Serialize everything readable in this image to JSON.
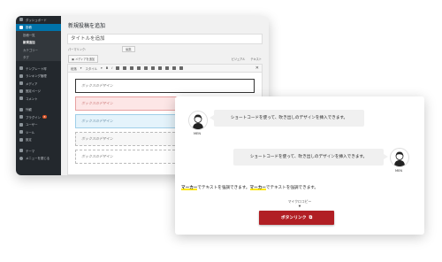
{
  "sidebar": {
    "items": [
      {
        "label": "ダッシュボード",
        "active": false
      },
      {
        "label": "投稿",
        "active": true
      },
      {
        "label": "投稿一覧",
        "sub": true
      },
      {
        "label": "新規追加",
        "sub": true,
        "current": true
      },
      {
        "label": "カテゴリー",
        "sub": true
      },
      {
        "label": "タグ",
        "sub": true
      },
      {
        "label": "テンプレート呼",
        "active": false
      },
      {
        "label": "ランキング管理",
        "active": false
      },
      {
        "label": "メディア",
        "active": false
      },
      {
        "label": "固定ページ",
        "active": false
      },
      {
        "label": "コメント",
        "active": false
      },
      {
        "label": "外観",
        "active": false
      },
      {
        "label": "プラグイン",
        "active": false,
        "badge": "8"
      },
      {
        "label": "ユーザー",
        "active": false
      },
      {
        "label": "ツール",
        "active": false
      },
      {
        "label": "設定",
        "active": false
      },
      {
        "label": "テーマ",
        "active": false
      },
      {
        "label": "メニューを閉じる",
        "active": false
      }
    ]
  },
  "editor": {
    "page_title": "新規投稿を追加",
    "title_placeholder": "タイトルを追加",
    "permalink_label": "パーマリンク:",
    "permalink_button": "編集",
    "add_media": "メディアを追加",
    "tab_visual": "ビジュアル",
    "tab_text": "テキスト",
    "format_select": "段落",
    "style_select": "スタイル",
    "boxes": [
      "ボックスのデザイン",
      "ボックスのデザイン",
      "ボックスのデザイン",
      "ボックスのデザイン",
      "ボックスのデザイン"
    ]
  },
  "preview": {
    "bubble_left": {
      "text": "ショートコードを使って、吹き出しのデザインを挿入できます。",
      "name": "MEN"
    },
    "bubble_right": {
      "text": "ショートコードを使って、吹き出しのデザインを挿入できます。",
      "name": "MEN"
    },
    "marker_line": {
      "m1": "マーカー",
      "t1": "でテキストを強調できます。",
      "m2": "マーカー",
      "t2": "でテキストを強調できます。"
    },
    "microcopy": "マイクロコピー",
    "cta_label": "ボタンリンク"
  },
  "colors": {
    "admin_sidebar": "#23282d",
    "admin_active": "#0073aa",
    "cta_red": "#b11f24",
    "marker_yellow": "#ffe600"
  }
}
